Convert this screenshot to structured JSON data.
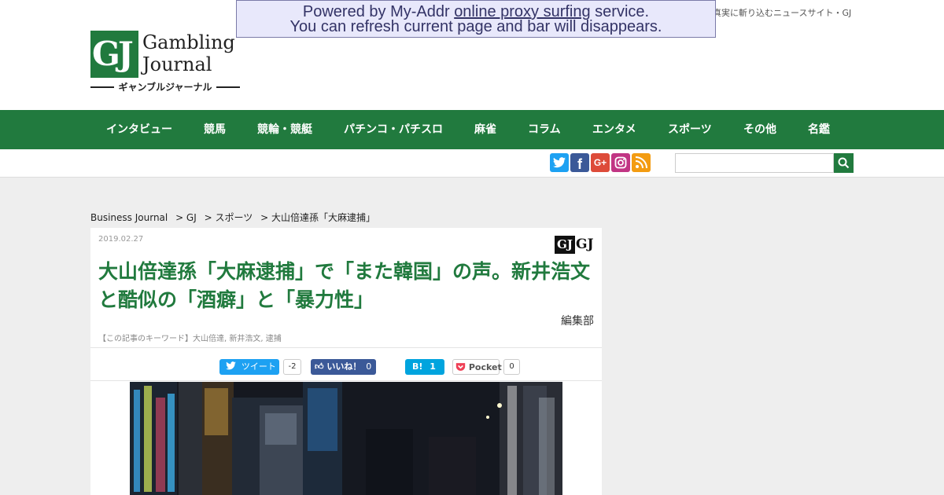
{
  "header": {
    "tagline": "真実に斬り込むニュースサイト・GJ",
    "logo": {
      "mark": "GJ",
      "word1": "Gambling",
      "word2": "Journal",
      "sub": "ギャンブルジャーナル"
    }
  },
  "proxy_banner": {
    "line1_before": "Powered by My-Addr ",
    "line1_link": "online proxy surfing",
    "line1_after": " service.",
    "line2": "You can refresh current page and bar will disappears."
  },
  "nav": {
    "items": [
      "インタビュー",
      "競馬",
      "競輪・競艇",
      "パチンコ・パチスロ",
      "麻雀",
      "コラム",
      "エンタメ",
      "スポーツ",
      "その他",
      "名鑑"
    ]
  },
  "social_icons": [
    "twitter-icon",
    "facebook-icon",
    "google-plus-icon",
    "instagram-icon",
    "rss-icon"
  ],
  "search": {
    "placeholder": ""
  },
  "breadcrumb": {
    "items": [
      "Business Journal",
      "> GJ",
      "> スポーツ",
      "> 大山倍達孫「大麻逮捕」"
    ]
  },
  "article": {
    "date": "2019.02.27",
    "badge_mark": "GJ",
    "badge_text": "GJ",
    "title": "大山倍達孫「大麻逮捕」で「また韓国」の声。新井浩文と酷似の「酒癖」と「暴力性」",
    "author": "編集部",
    "keywords": "【この記事のキーワード】大山倍達, 新井浩文, 逮捕",
    "share": {
      "tweet_label": "ツイート",
      "tweet_count": "-2",
      "like_label": "いいね！",
      "like_count": "0",
      "hatena_label": "B!",
      "hatena_count": "1",
      "pocket_label": "Pocket",
      "pocket_count": "0"
    }
  },
  "colors": {
    "brand_green": "#217a3e",
    "twitter": "#1da1f2",
    "facebook": "#3b5998",
    "google_plus": "#dd4b39",
    "instagram": "#c13584",
    "rss": "#f39c12",
    "hatena": "#00a4de",
    "pocket": "#ef4056"
  }
}
